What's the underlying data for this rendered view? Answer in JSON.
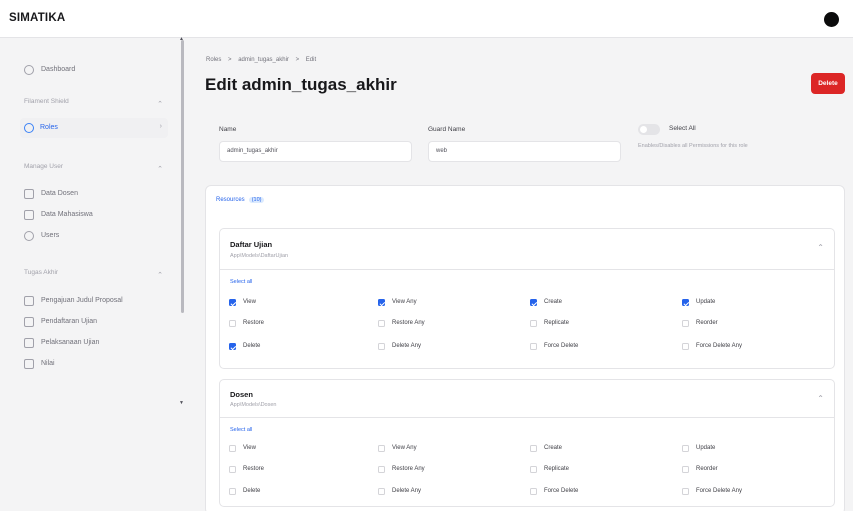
{
  "app": {
    "brand": "SIMATIKA"
  },
  "sidebar": {
    "dashboard": "Dashboard",
    "groups": [
      {
        "label": "Filament Shield",
        "items": [
          {
            "label": "Roles",
            "active": true
          }
        ]
      },
      {
        "label": "Manage User",
        "items": [
          {
            "label": "Data Dosen"
          },
          {
            "label": "Data Mahasiswa"
          },
          {
            "label": "Users"
          }
        ]
      },
      {
        "label": "Tugas Akhir",
        "items": [
          {
            "label": "Pengajuan Judul Proposal"
          },
          {
            "label": "Pendaftaran Ujian"
          },
          {
            "label": "Pelaksanaan Ujian"
          },
          {
            "label": "Nilai"
          }
        ]
      }
    ]
  },
  "breadcrumb": [
    "Roles",
    ">",
    "admin_tugas_akhir",
    ">",
    "Edit"
  ],
  "page": {
    "title": "Edit admin_tugas_akhir",
    "delete_label": "Delete"
  },
  "form": {
    "name_label": "Name",
    "name_value": "admin_tugas_akhir",
    "guard_label": "Guard Name",
    "guard_value": "web",
    "select_all_label": "Select All",
    "select_all_hint": "Enables/Disables all Permissions for this role"
  },
  "tabs": {
    "resources_label": "Resources",
    "resources_count": "(10)"
  },
  "sections": [
    {
      "title": "Daftar Ujian",
      "subtitle": "App\\Models\\DaftarUjian",
      "select_all": "Select all",
      "permissions": [
        {
          "label": "View",
          "checked": true
        },
        {
          "label": "View Any",
          "checked": true
        },
        {
          "label": "Create",
          "checked": true
        },
        {
          "label": "Update",
          "checked": true
        },
        {
          "label": "Restore",
          "checked": false
        },
        {
          "label": "Restore Any",
          "checked": false
        },
        {
          "label": "Replicate",
          "checked": false
        },
        {
          "label": "Reorder",
          "checked": false
        },
        {
          "label": "Delete",
          "checked": true
        },
        {
          "label": "Delete Any",
          "checked": false
        },
        {
          "label": "Force Delete",
          "checked": false
        },
        {
          "label": "Force Delete Any",
          "checked": false
        }
      ]
    },
    {
      "title": "Dosen",
      "subtitle": "App\\Models\\Dosen",
      "select_all": "Select all",
      "permissions": [
        {
          "label": "View",
          "checked": false
        },
        {
          "label": "View Any",
          "checked": false
        },
        {
          "label": "Create",
          "checked": false
        },
        {
          "label": "Update",
          "checked": false
        },
        {
          "label": "Restore",
          "checked": false
        },
        {
          "label": "Restore Any",
          "checked": false
        },
        {
          "label": "Replicate",
          "checked": false
        },
        {
          "label": "Reorder",
          "checked": false
        },
        {
          "label": "Delete",
          "checked": false
        },
        {
          "label": "Delete Any",
          "checked": false
        },
        {
          "label": "Force Delete",
          "checked": false
        },
        {
          "label": "Force Delete Any",
          "checked": false
        }
      ]
    }
  ],
  "colors": {
    "accent": "#2563eb",
    "danger": "#dc2626",
    "background": "#f4f4f5"
  }
}
